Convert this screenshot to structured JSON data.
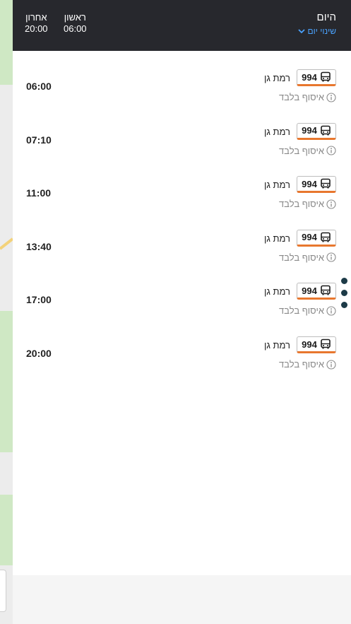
{
  "header": {
    "title": "היום",
    "change_day": "שינוי יום",
    "first_label": "ראשון",
    "first_time": "06:00",
    "last_label": "אחרון",
    "last_time": "20:00"
  },
  "departures": [
    {
      "time": "06:00",
      "line": "994",
      "destination": "רמת גן",
      "note": "איסוף בלבד"
    },
    {
      "time": "07:10",
      "line": "994",
      "destination": "רמת גן",
      "note": "איסוף בלבד"
    },
    {
      "time": "11:00",
      "line": "994",
      "destination": "רמת גן",
      "note": "איסוף בלבד"
    },
    {
      "time": "13:40",
      "line": "994",
      "destination": "רמת גן",
      "note": "איסוף בלבד"
    },
    {
      "time": "17:00",
      "line": "994",
      "destination": "רמת גן",
      "note": "איסוף בלבד"
    },
    {
      "time": "20:00",
      "line": "994",
      "destination": "רמת גן",
      "note": "איסוף בלבד"
    }
  ],
  "colors": {
    "header_bg": "#27282d",
    "accent_blue": "#4aa3ff",
    "line_orange": "#e8772e",
    "map_green": "#cfe8c4",
    "dots": "#1c3a47"
  },
  "icons": {
    "bus": "bus-icon",
    "info": "info-icon",
    "chevron": "chevron-down-icon"
  }
}
